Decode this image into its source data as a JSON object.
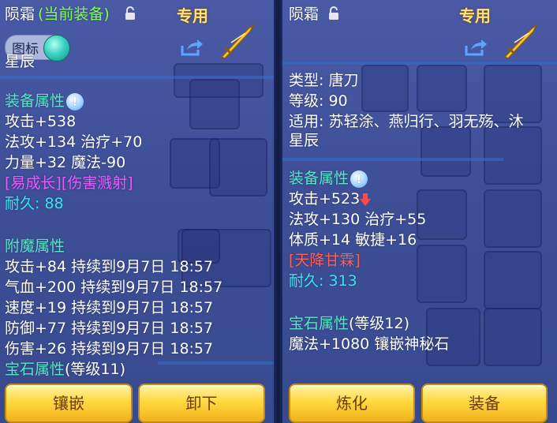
{
  "left": {
    "item_name": "陨霜",
    "equipped_tag": "(当前装备)",
    "exclusive_tag": "专用",
    "icon_toggle_label": "图标",
    "partial_line": "星辰",
    "equip_attr_title": "装备属性",
    "equip_attrs": [
      "攻击+538",
      "法攻+134 治疗+70",
      "力量+32 魔法-90"
    ],
    "special_effect": "[易成长][伤害溅射]",
    "durability_label": "耐久:",
    "durability_value": "88",
    "enchant_title": "附魔属性",
    "enchant_attrs": [
      "攻击+84 持续到9月7日 18:57",
      "气血+200 持续到9月7日 18:57",
      "速度+19 持续到9月7日 18:57",
      "防御+77 持续到9月7日 18:57",
      "伤害+26 持续到9月7日 18:57"
    ],
    "gem_title": "宝石属性",
    "gem_level": "(等级11)",
    "buttons": {
      "inlay": "镶嵌",
      "unequip": "卸下"
    }
  },
  "right": {
    "item_name": "陨霜",
    "exclusive_tag": "专用",
    "type_line": "类型: 唐刀",
    "level_line": "等级: 90",
    "suit_line": "适用: 苏轻涂、燕归行、羽无殇、沐",
    "suit_line_cont": "星辰",
    "equip_attr_title": "装备属性",
    "equip_attrs": [
      "攻击+523",
      "法攻+130 治疗+55",
      "体质+14 敏捷+16"
    ],
    "special_effect": "[天降甘霖]",
    "durability_label": "耐久:",
    "durability_value": "313",
    "gem_title": "宝石属性",
    "gem_level": "(等级12)",
    "gem_attr": "魔法+1080 镶嵌神秘石",
    "buttons": {
      "refine": "炼化",
      "equip": "装备"
    }
  },
  "colors": {
    "green": "#7dff55",
    "cyan": "#37e6f2",
    "section": "#59e6c8",
    "magenta": "#e85cff",
    "red": "#ff5f5f",
    "button": "#ffd93f"
  },
  "icons": [
    "lock-icon",
    "share-icon",
    "sword-icon",
    "info-icon",
    "down-arrow-icon"
  ],
  "stat_changes": {
    "right_attack": "down"
  }
}
